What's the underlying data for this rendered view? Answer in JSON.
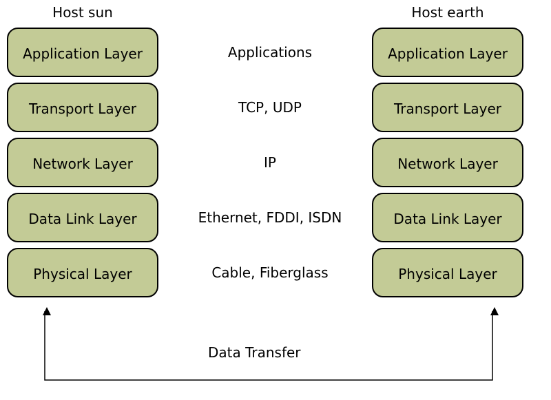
{
  "hosts": {
    "left": {
      "title": "Host sun"
    },
    "right": {
      "title": "Host earth"
    }
  },
  "layers": [
    {
      "name": "Application Layer",
      "protocols": "Applications"
    },
    {
      "name": "Transport Layer",
      "protocols": "TCP, UDP"
    },
    {
      "name": "Network Layer",
      "protocols": "IP"
    },
    {
      "name": "Data Link Layer",
      "protocols": "Ethernet, FDDI, ISDN"
    },
    {
      "name": "Physical Layer",
      "protocols": "Cable, Fiberglass"
    }
  ],
  "transfer_label": "Data Transfer"
}
